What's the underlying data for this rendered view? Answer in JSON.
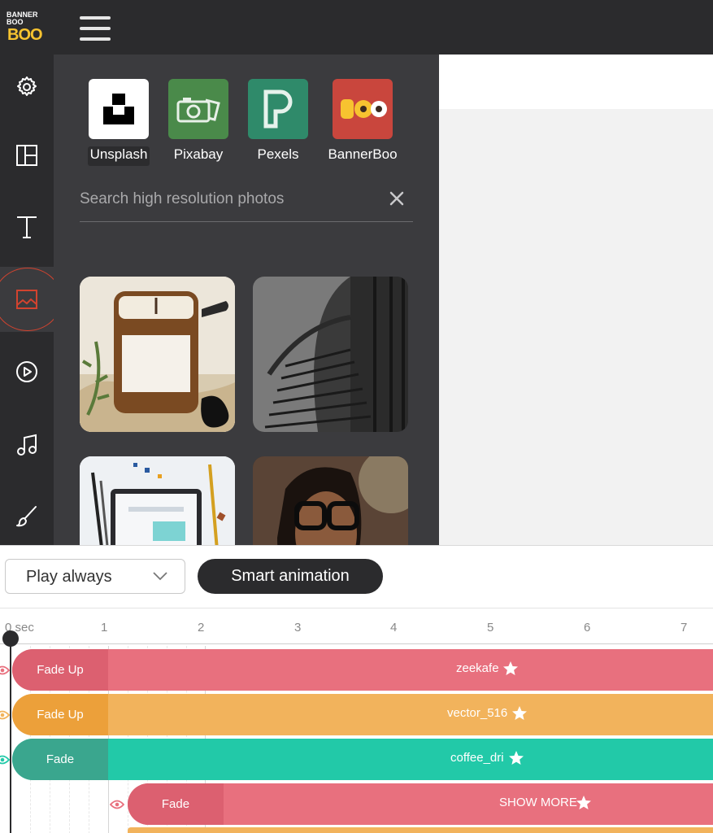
{
  "app": {
    "logo_line1": "BANNER",
    "logo_line2": "BOO",
    "logo_mark": "BOO",
    "menu_icon": "hamburger-icon"
  },
  "sidebar": {
    "items": [
      {
        "name": "settings",
        "icon": "gear-icon"
      },
      {
        "name": "layouts",
        "icon": "layout-icon"
      },
      {
        "name": "text",
        "icon": "text-icon"
      },
      {
        "name": "images",
        "icon": "image-icon",
        "active": true
      },
      {
        "name": "video",
        "icon": "play-icon"
      },
      {
        "name": "audio",
        "icon": "music-note-icon"
      },
      {
        "name": "brush",
        "icon": "brush-icon"
      }
    ],
    "active_color": "#d2432f"
  },
  "media_panel": {
    "sources": [
      {
        "label": "Unsplash",
        "icon": "unsplash-logo",
        "color": "#ffffff"
      },
      {
        "label": "Pixabay",
        "icon": "pixabay-logo",
        "color": "#4a8a4a"
      },
      {
        "label": "Pexels",
        "icon": "pexels-logo",
        "color": "#2f8a6a"
      },
      {
        "label": "BannerBoo",
        "icon": "bannerboo-logo",
        "color": "#c9463d"
      }
    ],
    "search": {
      "placeholder": "Search high resolution photos",
      "value": ""
    },
    "photos": [
      "candle jar with plants",
      "dark staircase",
      "laptop with pens",
      "woman with glasses"
    ]
  },
  "timeline": {
    "play_mode": "Play always",
    "smart_animation_label": "Smart animation",
    "ruler": {
      "unit_label": "0 sec",
      "ticks": [
        "1",
        "2",
        "3",
        "4",
        "5",
        "6",
        "7"
      ]
    },
    "tracks": [
      {
        "animation": "Fade Up",
        "name": "zeekafe",
        "color": "#e8707e",
        "anim_color": "#dc6070"
      },
      {
        "animation": "Fade Up",
        "name": "vector_516",
        "color": "#f2b35c",
        "anim_color": "#eca03a"
      },
      {
        "animation": "Fade",
        "name": "coffee_dri",
        "color": "#22c9a8",
        "anim_color": "#3aa68e"
      },
      {
        "animation": "Fade",
        "name": "SHOW MORE",
        "color": "#e8707e",
        "anim_color": "#dc6070"
      }
    ]
  }
}
